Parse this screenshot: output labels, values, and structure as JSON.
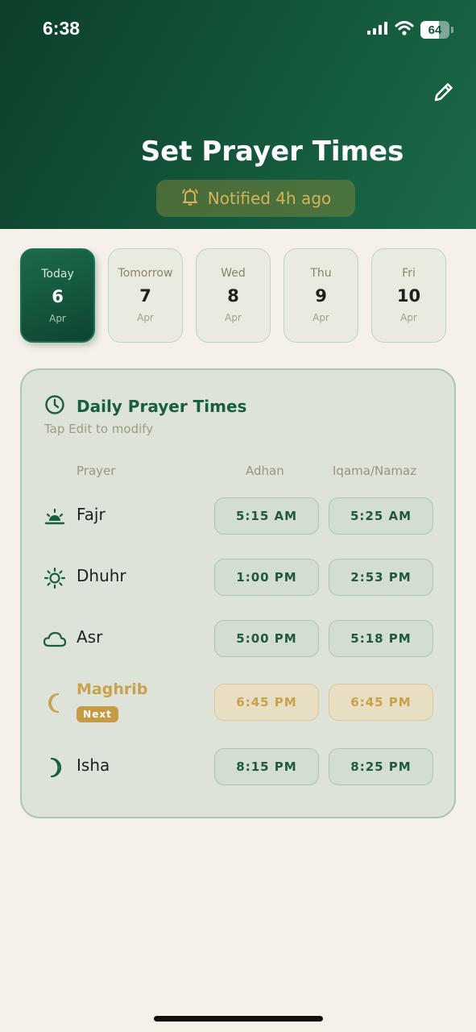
{
  "status_bar": {
    "time": "6:38",
    "battery": "64"
  },
  "header": {
    "title": "Set Prayer Times",
    "notified": "Notified 4h ago"
  },
  "dates": [
    {
      "day": "Today",
      "num": "6",
      "month": "Apr"
    },
    {
      "day": "Tomorrow",
      "num": "7",
      "month": "Apr"
    },
    {
      "day": "Wed",
      "num": "8",
      "month": "Apr"
    },
    {
      "day": "Thu",
      "num": "9",
      "month": "Apr"
    },
    {
      "day": "Fri",
      "num": "10",
      "month": "Apr"
    }
  ],
  "card": {
    "title": "Daily Prayer Times",
    "subtitle": "Tap Edit to modify",
    "columns": {
      "prayer": "Prayer",
      "adhan": "Adhan",
      "iqama": "Iqama/Namaz"
    },
    "next_label": "Next",
    "prayers": [
      {
        "name": "Fajr",
        "icon": "sunrise-icon",
        "adhan": "5:15 AM",
        "iqama": "5:25 AM"
      },
      {
        "name": "Dhuhr",
        "icon": "sun-icon",
        "adhan": "1:00 PM",
        "iqama": "2:53 PM"
      },
      {
        "name": "Asr",
        "icon": "cloud-icon",
        "adhan": "5:00 PM",
        "iqama": "5:18 PM"
      },
      {
        "name": "Maghrib",
        "icon": "crescent-moon-icon",
        "adhan": "6:45 PM",
        "iqama": "6:45 PM"
      },
      {
        "name": "Isha",
        "icon": "moon-icon",
        "adhan": "8:15 PM",
        "iqama": "8:25 PM"
      }
    ]
  },
  "colors": {
    "primary": "#13553a",
    "accent_gold": "#c9a24e",
    "background": "#f5f1ea"
  }
}
